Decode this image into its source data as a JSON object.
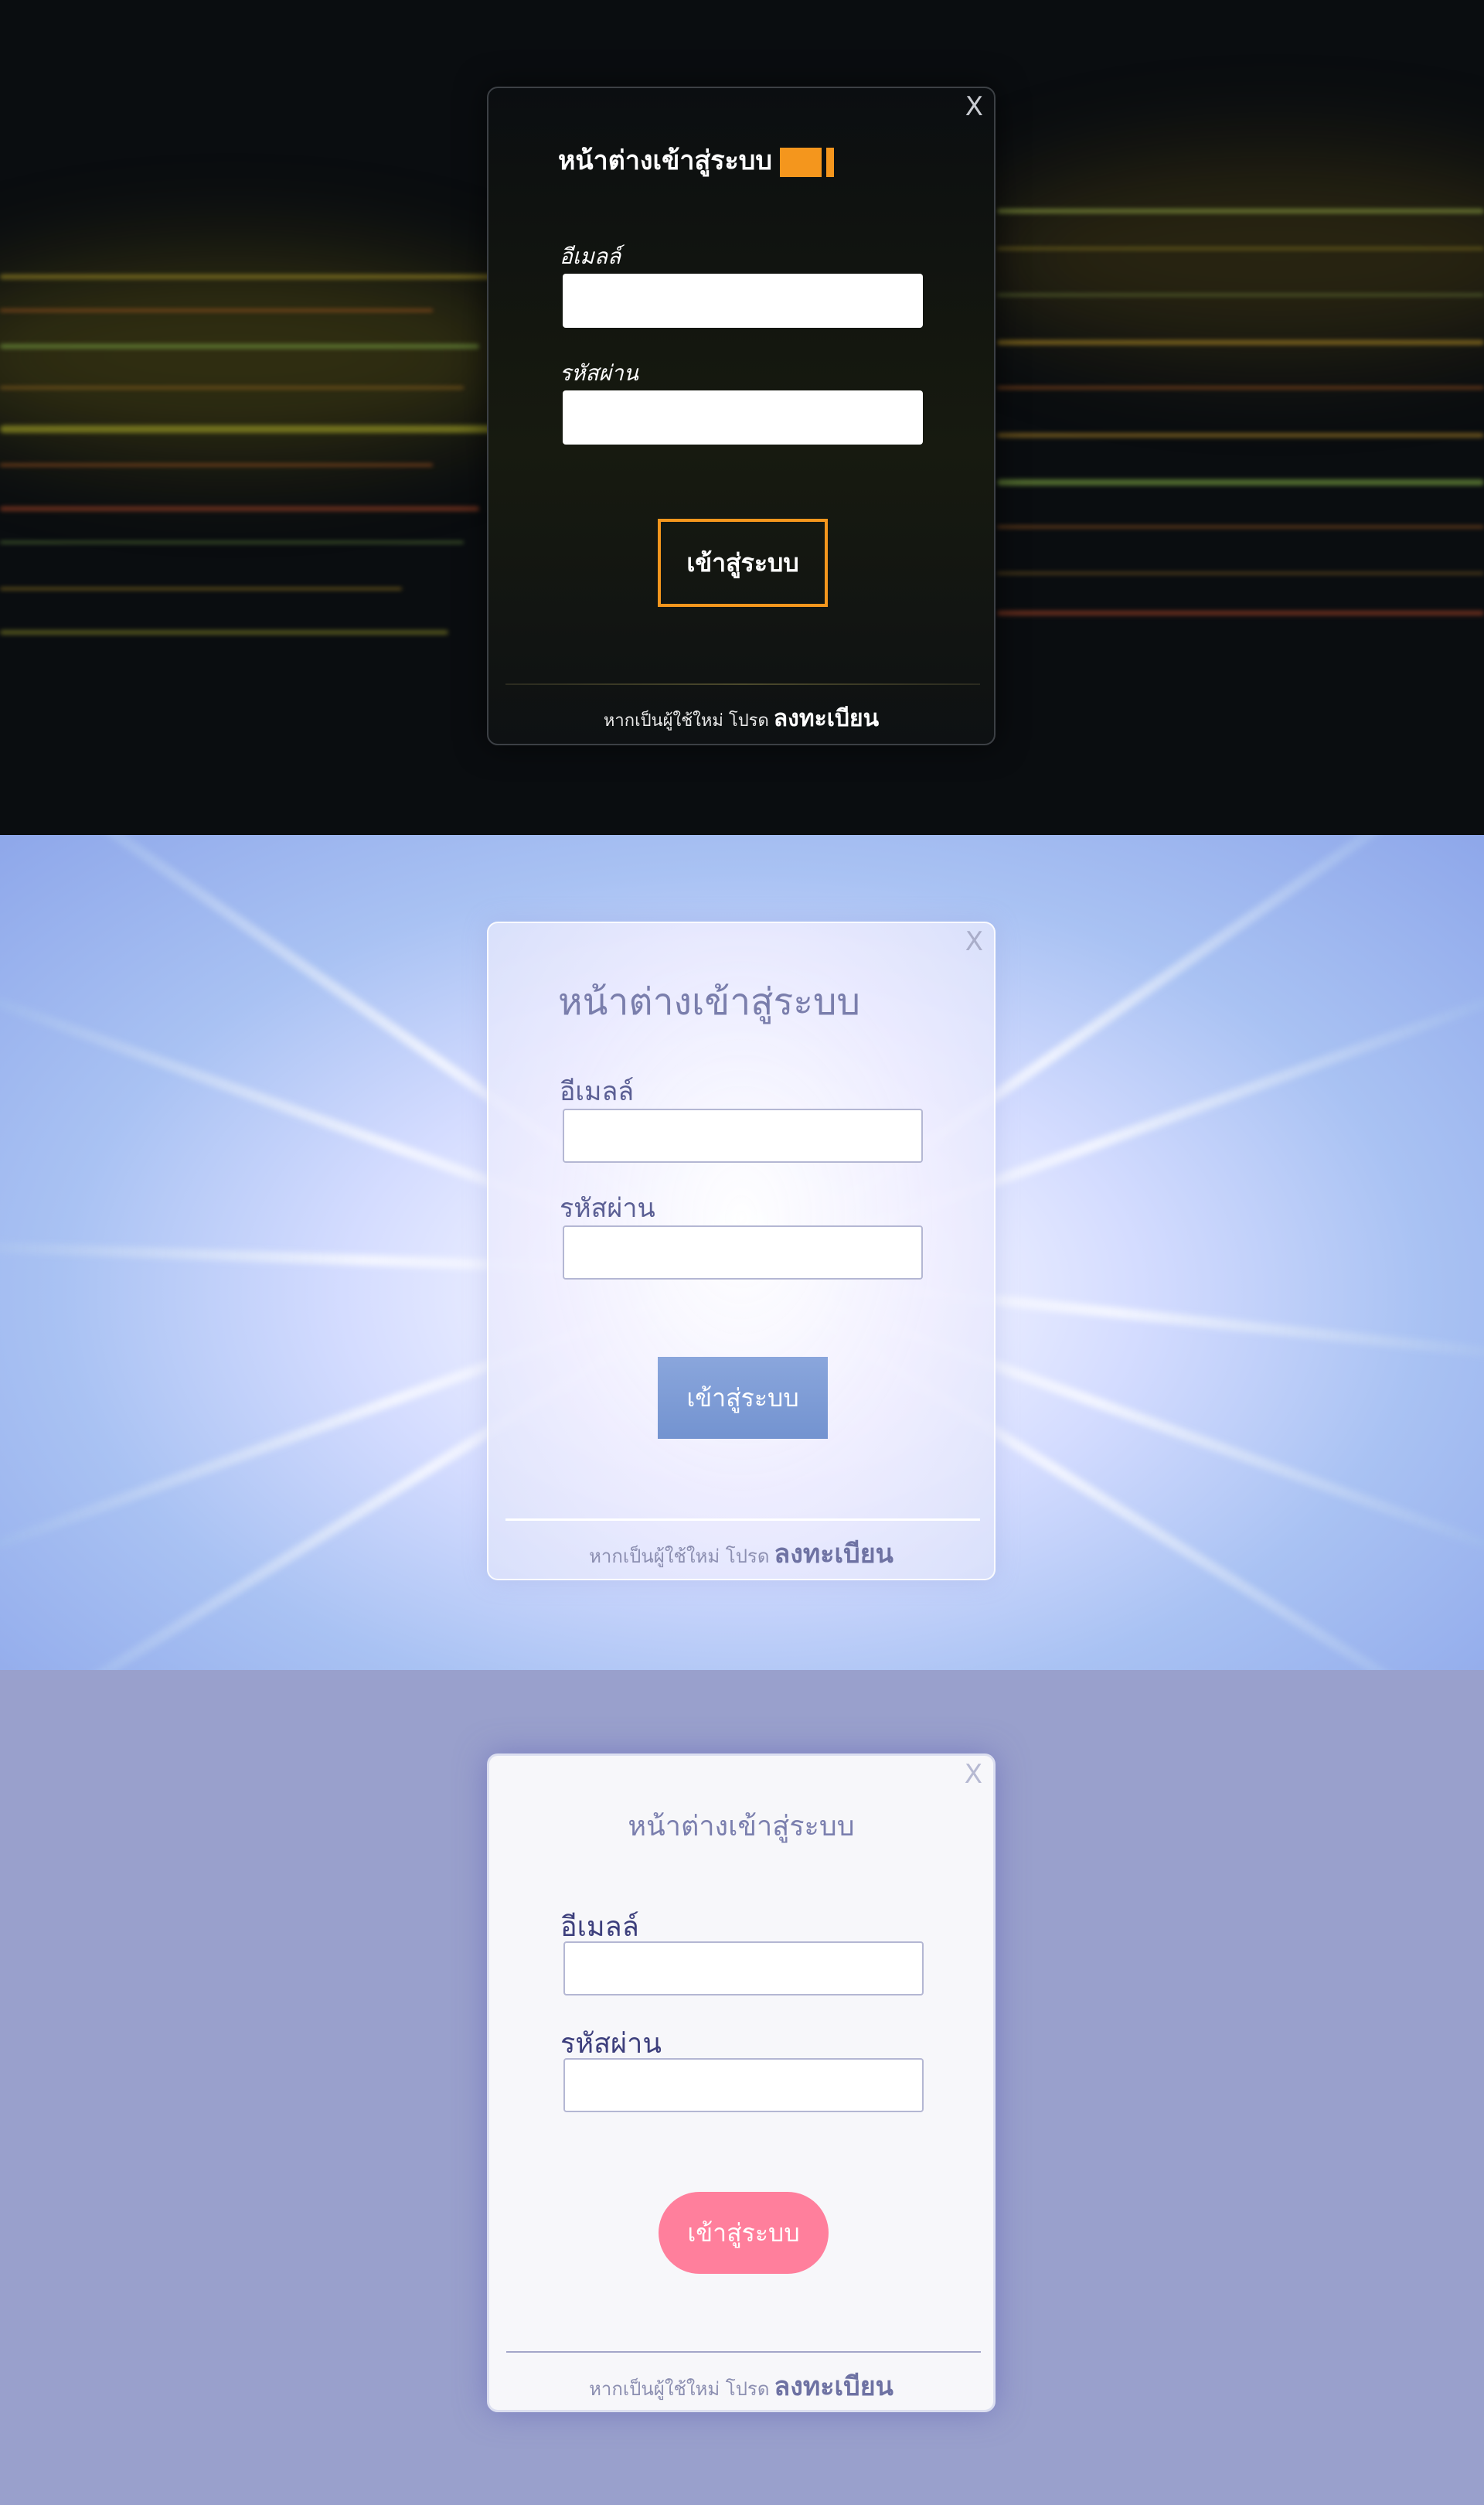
{
  "modals": [
    {
      "close_label": "X",
      "title": "หน้าต่างเข้าสู่ระบบ",
      "email_label": "อีเมลล์",
      "email_value": "",
      "password_label": "รหัสผ่าน",
      "password_value": "",
      "login_button": "เข้าสู่ระบบ",
      "footer_text": "หากเป็นผู้ใช้ใหม่ โปรด",
      "footer_link": "ลงทะเบียน",
      "accent_color": "#f4961d"
    },
    {
      "close_label": "X",
      "title": "หน้าต่างเข้าสู่ระบบ",
      "email_label": "อีเมลล์",
      "email_value": "",
      "password_label": "รหัสผ่าน",
      "password_value": "",
      "login_button": "เข้าสู่ระบบ",
      "footer_text": "หากเป็นผู้ใช้ใหม่ โปรด",
      "footer_link": "ลงทะเบียน",
      "accent_color": "#7f9cd6"
    },
    {
      "close_label": "X",
      "title": "หน้าต่างเข้าสู่ระบบ",
      "email_label": "อีเมลล์",
      "email_value": "",
      "password_label": "รหัสผ่าน",
      "password_value": "",
      "login_button": "เข้าสู่ระบบ",
      "footer_text": "หากเป็นผู้ใช้ใหม่ โปรด",
      "footer_link": "ลงทะเบียน",
      "accent_color": "#ff7f9c"
    }
  ]
}
